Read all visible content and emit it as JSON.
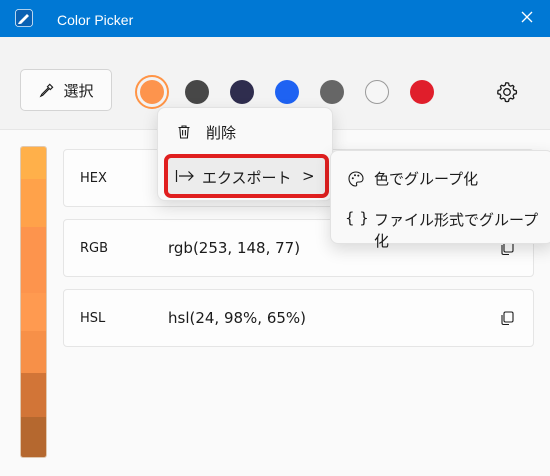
{
  "window": {
    "title": "Color Picker"
  },
  "toolbar": {
    "select_label": "選択",
    "swatches": [
      {
        "color": "#fd944d",
        "selected": true
      },
      {
        "color": "#474747"
      },
      {
        "color": "#2f2d4e"
      },
      {
        "color": "#1e62f2"
      },
      {
        "color": "#666666"
      },
      {
        "color": "#f6f6f6"
      },
      {
        "color": "#e01e2b"
      }
    ]
  },
  "gradient_colors": [
    "#ffb04a",
    "#ffa24a",
    "#fd944d",
    "#ff9a50",
    "#f79048",
    "#d27537",
    "#b5682f"
  ],
  "cards": [
    {
      "label": "HEX",
      "value": ""
    },
    {
      "label": "RGB",
      "value": "rgb(253, 148, 77)"
    },
    {
      "label": "HSL",
      "value": "hsl(24, 98%, 65%)"
    }
  ],
  "context_menu": {
    "delete_label": "削除",
    "export_label": "エクスポート",
    "export_chevron": ">"
  },
  "submenu": {
    "group_by_color": "色でグループ化",
    "group_by_format": "ファイル形式でグループ化",
    "brace_icon": "{ }"
  },
  "colors": {
    "accent": "#0078d4",
    "highlight_border": "#e01f1f"
  }
}
